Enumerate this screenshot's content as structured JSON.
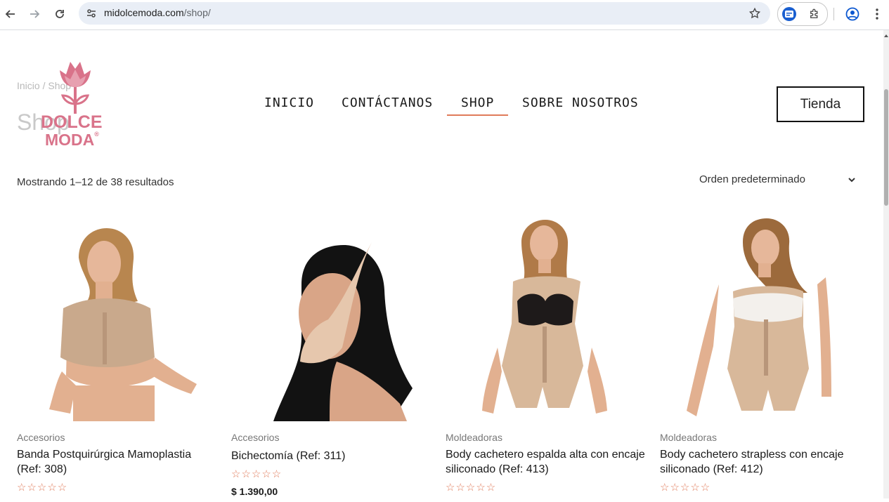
{
  "browser": {
    "url_host": "midolcemoda.com",
    "url_path": "/shop/",
    "icons": [
      "back-icon",
      "forward-icon",
      "reload-icon",
      "site-info-icon",
      "star-icon",
      "extension-icon",
      "puzzle-icon",
      "profile-icon",
      "menu-icon"
    ]
  },
  "site": {
    "breadcrumb": "Inicio / Shop",
    "page_title": "Shop",
    "logo_line1": "DOLCE",
    "logo_line2": "MODA",
    "logo_reg": "®",
    "brand_color": "#d9738a"
  },
  "nav": {
    "items": [
      {
        "label": "INICIO"
      },
      {
        "label": "CONTÁCTANOS"
      },
      {
        "label": "SHOP"
      },
      {
        "label": "SOBRE NOSOTROS"
      }
    ],
    "active": "SHOP",
    "accent": "#e07b5a",
    "cta_label": "Tienda"
  },
  "shop": {
    "result_count": "Mostrando 1–12 de 38 resultados",
    "orderby_selected": "Orden predeterminado"
  },
  "products": [
    {
      "category": "Accesorios",
      "title": "Banda Postquirúrgica Mamoplastia (Ref: 308)",
      "stars": "☆☆☆☆☆",
      "price": ""
    },
    {
      "category": "Accesorios",
      "title": "Bichectomía (Ref: 311)",
      "stars": "☆☆☆☆☆",
      "price": "$ 1.390,00"
    },
    {
      "category": "Moldeadoras",
      "title": "Body cachetero espalda alta con encaje siliconado (Ref: 413)",
      "stars": "☆☆☆☆☆",
      "price": ""
    },
    {
      "category": "Moldeadoras",
      "title": "Body cachetero strapless con encaje siliconado (Ref: 412)",
      "stars": "☆☆☆☆☆",
      "price": ""
    }
  ]
}
